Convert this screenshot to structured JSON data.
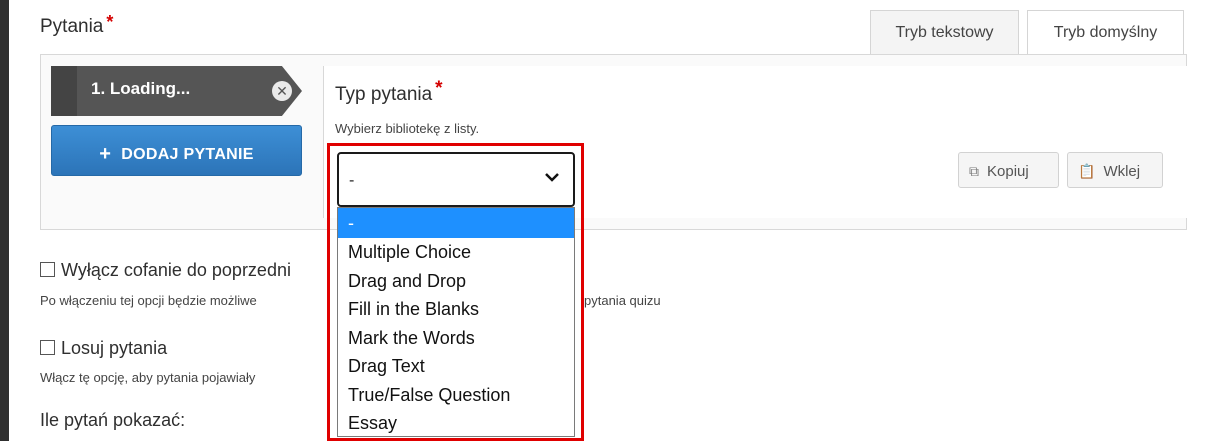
{
  "section": {
    "label": "Pytania",
    "required_mark": "*"
  },
  "mode_tabs": [
    "Tryb tekstowy",
    "Tryb domyślny"
  ],
  "question_list": {
    "item_label": "1. Loading...",
    "remove_icon": "close-circle-icon",
    "add_button": "DODAJ PYTANIE"
  },
  "question_type": {
    "title": "Typ pytania",
    "required_mark": "*",
    "description": "Wybierz bibliotekę z listy.",
    "selected": "-",
    "options": [
      "-",
      "Multiple Choice",
      "Drag and Drop",
      "Fill in the Blanks",
      "Mark the Words",
      "Drag Text",
      "True/False Question",
      "Essay"
    ]
  },
  "toolbar": {
    "copy": "Kopiuj",
    "paste": "Wklej"
  },
  "options": {
    "disable_back": {
      "label": "Wyłącz cofanie do poprzedni",
      "help": "Po włączeniu tej opcji będzie możliwe",
      "help_tail": "pytania quizu"
    },
    "shuffle": {
      "label": "Losuj pytania",
      "help": "Włącz tę opcję, aby pytania pojawiały"
    },
    "count_heading": "Ile pytań pokazać:"
  },
  "colors": {
    "accent": "#2c74b8",
    "highlight": "#e00000",
    "selected_option": "#1e90ff"
  }
}
